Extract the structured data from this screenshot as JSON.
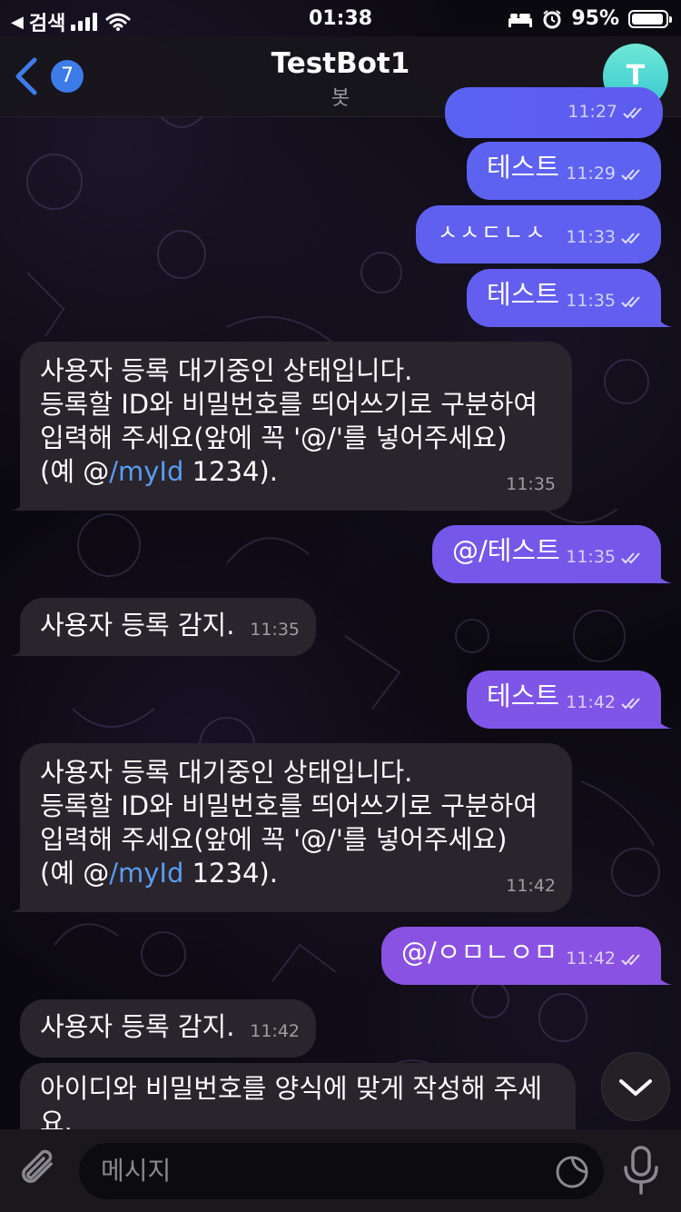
{
  "status_bar": {
    "carrier": "검색",
    "time": "01:38",
    "battery": "95%",
    "battery_level": 0.95
  },
  "header": {
    "back_count": "7",
    "title": "TestBot1",
    "subtitle": "봇",
    "avatar_letter": "T"
  },
  "messages": [
    {
      "text": "",
      "time": "11:27"
    },
    {
      "text": "테스트",
      "time": "11:29"
    },
    {
      "text": "ㅅㅅㄷㄴㅅ",
      "time": "11:33"
    },
    {
      "text": "테스트",
      "time": "11:35"
    },
    {
      "line1": "사용자 등록 대기중인 상태입니다.",
      "line2": "등록할 ID와 비밀번호를 띄어쓰기로 구분하여",
      "line3": "입력해 주세요(앞에 꼭 '@/'를 넣어주세요)",
      "line4_pre": "(예 @",
      "line4_link": "/myId",
      "line4_post": " 1234).",
      "time": "11:35"
    },
    {
      "text": "@/테스트",
      "time": "11:35"
    },
    {
      "text": "사용자 등록 감지.",
      "time": "11:35"
    },
    {
      "text": "테스트",
      "time": "11:42"
    },
    {
      "line1": "사용자 등록 대기중인 상태입니다.",
      "line2": "등록할 ID와 비밀번호를 띄어쓰기로 구분하여",
      "line3": "입력해 주세요(앞에 꼭 '@/'를 넣어주세요)",
      "line4_pre": "(예 @",
      "line4_link": "/myId",
      "line4_post": " 1234).",
      "time": "11:42"
    },
    {
      "text": "@/ㅇㅁㄴㅇㅁ",
      "time": "11:42"
    },
    {
      "text": "사용자 등록 감지.",
      "time": "11:42"
    },
    {
      "text": "아이디와 비밀번호를 양식에 맞게 작성해 주세\n요.",
      "time": ""
    }
  ],
  "input": {
    "placeholder": "메시지"
  },
  "colors": {
    "outgoing_bubble_top": "#5b5ff0",
    "outgoing_bubble_bottom": "#8a52e2",
    "incoming_bubble": "#2a242c",
    "link": "#5a9cf0",
    "accent": "#3d7be8"
  },
  "icons": [
    "back-chevron-icon",
    "signal-icon",
    "wifi-icon",
    "bed-icon",
    "alarm-icon",
    "battery-icon",
    "double-check-icon",
    "attach-icon",
    "sticker-icon",
    "mic-icon",
    "chevron-down-icon"
  ]
}
